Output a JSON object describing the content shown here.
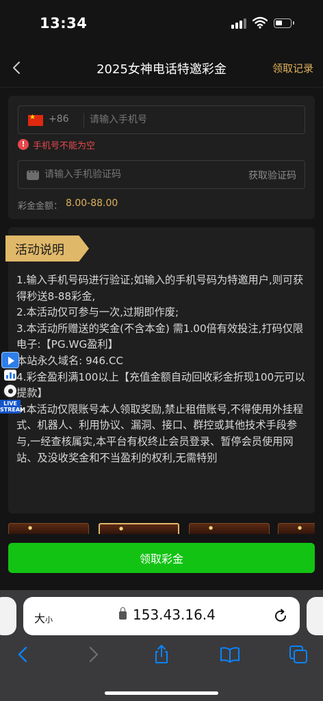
{
  "status_bar": {
    "time": "13:34"
  },
  "nav": {
    "title": "2025女神电话特邀彩金",
    "records_label": "领取记录"
  },
  "form": {
    "country_code": "+86",
    "phone_placeholder": "请输入手机号",
    "phone_error": "手机号不能为空",
    "code_placeholder": "请输入手机验证码",
    "get_code_label": "获取验证码",
    "amount_label": "彩金金额：",
    "amount_value": "8.00-88.00"
  },
  "description": {
    "title": "活动说明",
    "lines": [
      "1.输入手机号码进行验证;如输入的手机号码为特邀用户,则可获得秒送8-88彩金,",
      "2.本活动仅可参与一次,过期即作废;",
      "3.本活动所赠送的奖金(不含本金) 需1.00倍有效投注,打码仅限电子:【PG.WG盈利】",
      "本站永久域名: 946.CC",
      "4.彩金盈利满100以上【充值金额自动回收彩金折现100元可以提款】",
      "5.本活动仅限账号本人领取奖励,禁止租借账号,不得使用外挂程式、机器人、利用协议、漏洞、接口、群控或其他技术手段参与,一经查核属实,本平台有权终止会员登录、暂停会员使用网站、及没收奖金和不当盈利的权利,无需特别"
    ]
  },
  "live_widget": {
    "label": "LIVE STREAM"
  },
  "claim_button": {
    "label": "领取彩金"
  },
  "browser": {
    "text_size_label": "大",
    "text_size_small": "小",
    "url": "153.43.16.4"
  },
  "colors": {
    "accent_gold": "#e0b25a",
    "error_red": "#e5484d",
    "button_green": "#13c313",
    "ios_blue": "#0a84ff"
  }
}
